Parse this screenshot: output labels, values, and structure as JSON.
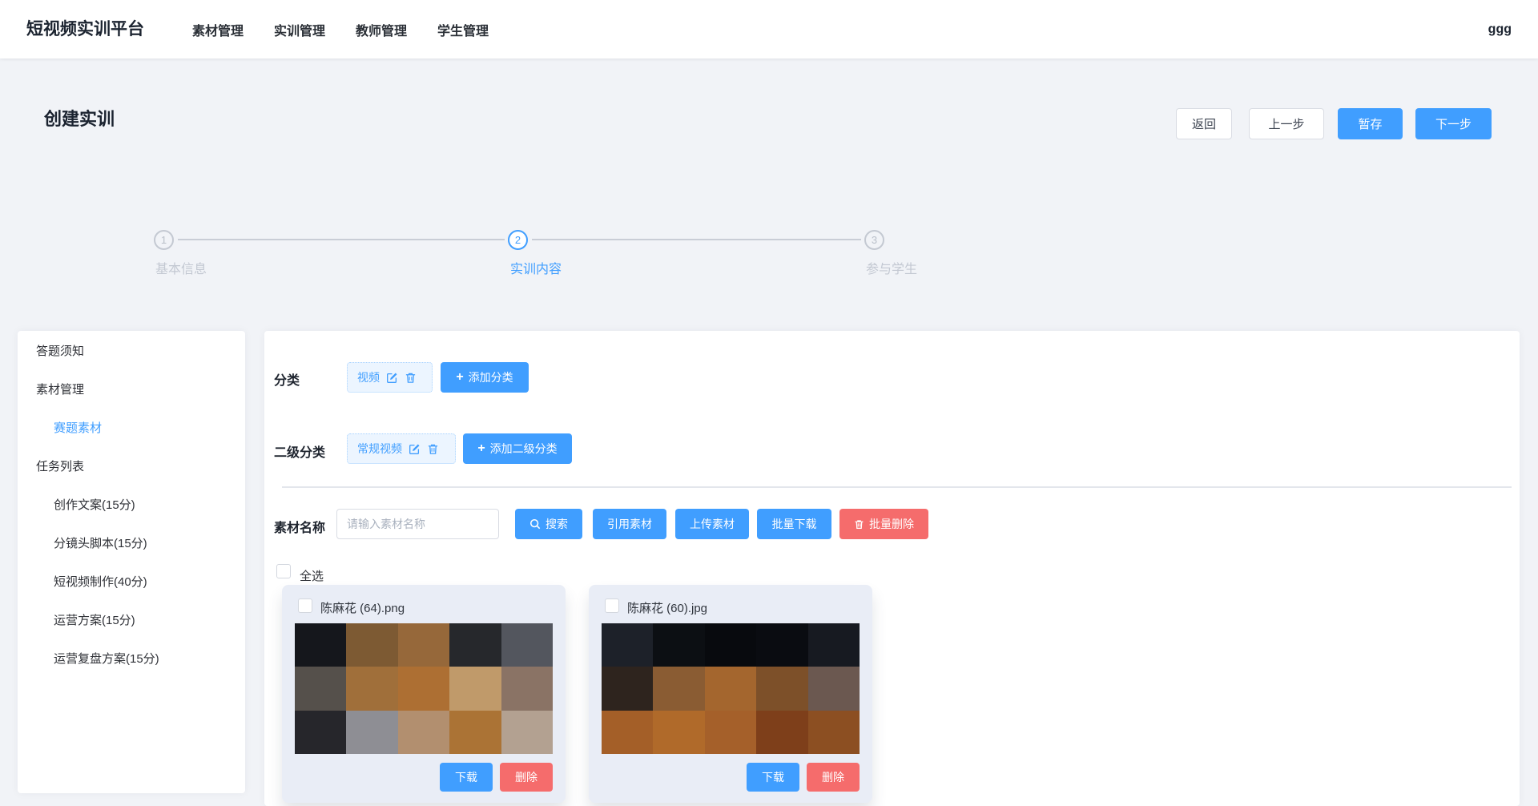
{
  "navbar": {
    "logo": "短视频实训平台",
    "items": [
      {
        "label": "素材管理"
      },
      {
        "label": "实训管理"
      },
      {
        "label": "教师管理"
      },
      {
        "label": "学生管理"
      }
    ],
    "user": "ggg"
  },
  "header": {
    "title": "创建实训",
    "actions": {
      "back": "返回",
      "prev": "上一步",
      "save_draft": "暂存",
      "next": "下一步"
    }
  },
  "steps": [
    {
      "number": "1",
      "label": "基本信息",
      "active": false
    },
    {
      "number": "2",
      "label": "实训内容",
      "active": true
    },
    {
      "number": "3",
      "label": "参与学生",
      "active": false
    }
  ],
  "sidebar": {
    "items": [
      {
        "label": "答题须知",
        "level": 1,
        "active": false
      },
      {
        "label": "素材管理",
        "level": 1,
        "active": false
      },
      {
        "label": "赛题素材",
        "level": 2,
        "active": true
      },
      {
        "label": "任务列表",
        "level": 1,
        "active": false
      },
      {
        "label": "创作文案(15分)",
        "level": 2,
        "active": false
      },
      {
        "label": "分镜头脚本(15分)",
        "level": 2,
        "active": false
      },
      {
        "label": "短视频制作(40分)",
        "level": 2,
        "active": false
      },
      {
        "label": "运营方案(15分)",
        "level": 2,
        "active": false
      },
      {
        "label": "运营复盘方案(15分)",
        "level": 2,
        "active": false
      }
    ]
  },
  "content": {
    "category": {
      "label": "分类",
      "tag": "视频",
      "add_button": "添加分类"
    },
    "subcategory": {
      "label": "二级分类",
      "tag": "常规视频",
      "add_button": "添加二级分类"
    },
    "material_search": {
      "label": "素材名称",
      "placeholder": "请输入素材名称",
      "search_button": "搜索",
      "quote_button": "引用素材",
      "upload_button": "上传素材",
      "batch_download_button": "批量下载",
      "batch_delete_button": "批量删除"
    },
    "select_all_label": "全选",
    "cards": [
      {
        "title": "陈麻花 (64).png",
        "download_label": "下载",
        "delete_label": "删除",
        "mosaic": [
          [
            "#15171c",
            "#7d5a33",
            "#96683a",
            "#26282c",
            "#53565e"
          ],
          [
            "#55504b",
            "#a06f3a",
            "#ad6f33",
            "#c09a6a",
            "#8a7365"
          ],
          [
            "#26262b",
            "#8e8e94",
            "#b28f6f",
            "#ab7335",
            "#b3a191"
          ]
        ]
      },
      {
        "title": "陈麻花 (60).jpg",
        "download_label": "下载",
        "delete_label": "删除",
        "mosaic": [
          [
            "#1d2129",
            "#0c0f13",
            "#080a0e",
            "#0a0c11",
            "#171a21"
          ],
          [
            "#2e241e",
            "#8a5c33",
            "#a4662e",
            "#7d5029",
            "#6b5850"
          ],
          [
            "#a45f28",
            "#b06a2a",
            "#a5602a",
            "#7e3f1a",
            "#8c4f22"
          ]
        ]
      }
    ]
  },
  "icons": {
    "plus": "+"
  },
  "colors": {
    "primary": "#409eff",
    "danger": "#f56c6c",
    "tag_bg": "#ecf5ff",
    "tag_border": "#a8d3ff",
    "page_bg": "#f1f3f7",
    "inactive_step": "#c3c8d2"
  }
}
